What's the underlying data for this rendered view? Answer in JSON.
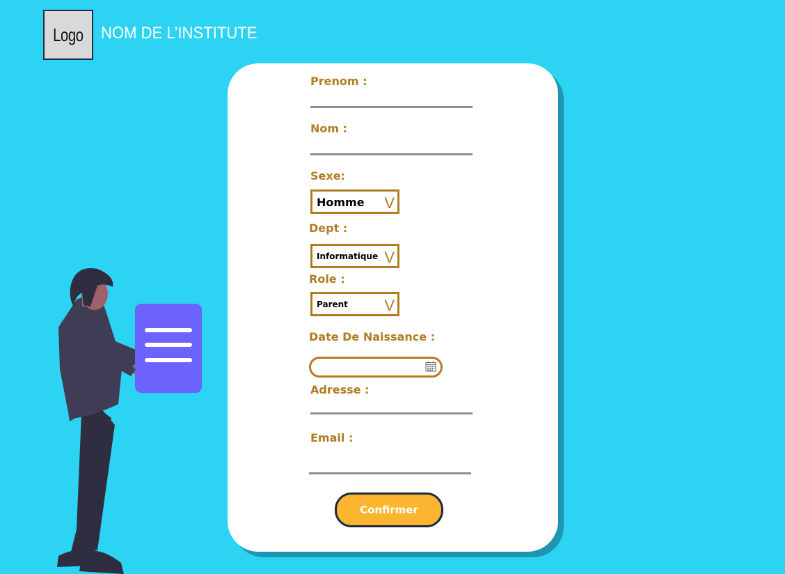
{
  "header": {
    "logo_text": "Logo",
    "institute_name": "NOM DE L’INSTITUTE"
  },
  "form": {
    "prenom_label": "Prenom :",
    "nom_label": "Nom :",
    "sexe_label": "Sexe:",
    "sexe_value": "Homme",
    "dept_label": "Dept :",
    "dept_value": "Informatique",
    "role_label": "Role :",
    "role_value": "Parent",
    "dropdown_glyph": "V",
    "dob_label": "Date De Naissance :",
    "adresse_label": "Adresse :",
    "email_label": "Email :",
    "confirm_label": "Confirmer"
  },
  "colors": {
    "background": "#2cd3f3",
    "label": "#b07d24",
    "button": "#fbb52e",
    "document": "#6c63ff"
  }
}
